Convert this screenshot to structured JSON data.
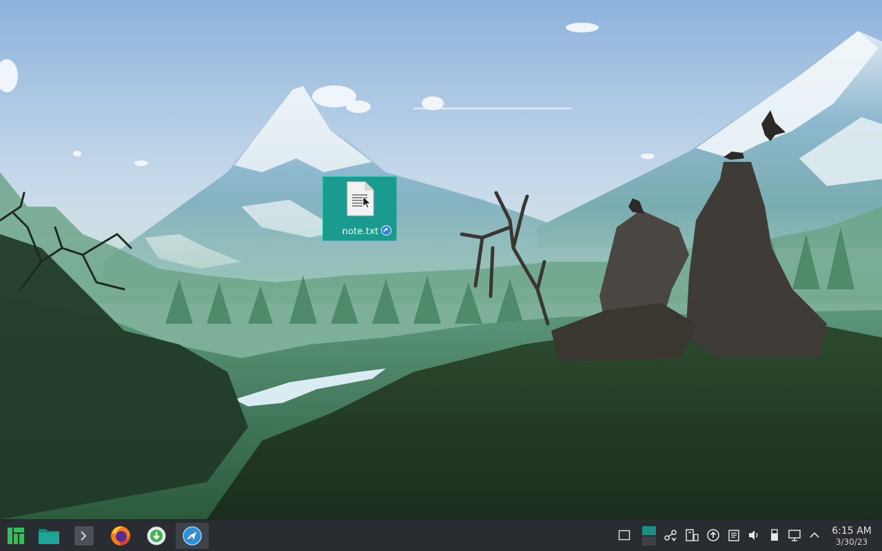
{
  "desktop": {
    "icon": {
      "label": "note.txt",
      "icon": "text-file-icon",
      "badge": "link-badge-icon"
    },
    "cursor": "arrow-cursor"
  },
  "taskbar": {
    "launchers": [
      {
        "name": "application-menu",
        "icon": "manjaro-logo-icon"
      },
      {
        "name": "file-manager",
        "icon": "folder-icon"
      },
      {
        "name": "terminal",
        "icon": "terminal-icon"
      },
      {
        "name": "firefox",
        "icon": "firefox-icon"
      },
      {
        "name": "software-updater",
        "icon": "download-icon"
      },
      {
        "name": "active-window",
        "icon": "kde-connect-icon"
      }
    ],
    "tray": [
      "show-desktop-icon",
      "pager-icon",
      "connections-icon",
      "clipboard-icon",
      "updates-icon",
      "notes-icon",
      "volume-icon",
      "usb-icon",
      "network-icon",
      "tray-expand-icon"
    ],
    "clock": {
      "time": "6:15 AM",
      "date": "3/30/23"
    }
  },
  "colors": {
    "taskbar_bg": "#292c30",
    "accent": "#1a9b8f"
  }
}
